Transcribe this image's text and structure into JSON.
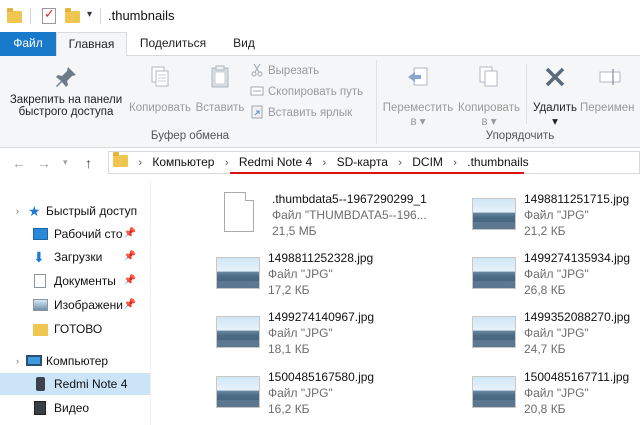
{
  "window": {
    "title": ".thumbnails"
  },
  "tabs": [
    {
      "label": "Файл"
    },
    {
      "label": "Главная"
    },
    {
      "label": "Поделиться"
    },
    {
      "label": "Вид"
    }
  ],
  "ribbon": {
    "clipboard": {
      "pin_label_1": "Закрепить на панели",
      "pin_label_2": "быстрого доступа",
      "copy_label": "Копировать",
      "paste_label": "Вставить",
      "cut_label": "Вырезать",
      "copy_path_label": "Скопировать путь",
      "paste_shortcut_label": "Вставить ярлык",
      "group_label": "Буфер обмена"
    },
    "organize": {
      "move_label": "Переместить",
      "move_sub": "в",
      "copyto_label": "Копировать",
      "copyto_sub": "в",
      "delete_label": "Удалить",
      "rename_label": "Переимен",
      "group_label": "Упорядочить"
    }
  },
  "address": {
    "crumbs": [
      "Компьютер",
      "Redmi Note 4",
      "SD-карта",
      "DCIM",
      ".thumbnails"
    ]
  },
  "nav": {
    "items": [
      {
        "label": "Быстрый доступ",
        "pinned": false
      },
      {
        "label": "Рабочий сто",
        "pinned": true
      },
      {
        "label": "Загрузки",
        "pinned": true
      },
      {
        "label": "Документы",
        "pinned": true
      },
      {
        "label": "Изображени",
        "pinned": true
      },
      {
        "label": "ГОТОВО",
        "pinned": false
      },
      {
        "label": "Компьютер",
        "pinned": false
      },
      {
        "label": "Redmi Note 4",
        "pinned": false
      },
      {
        "label": "Видео",
        "pinned": false
      }
    ]
  },
  "files": [
    {
      "name": ".thumbdata5--1967290299_1",
      "type": "Файл \"THUMBDATA5--196...",
      "size": "21,5 МБ",
      "icon": "document"
    },
    {
      "name": "1498811251715.jpg",
      "type": "Файл \"JPG\"",
      "size": "21,2 КБ",
      "icon": "image"
    },
    {
      "name": "1498811252328.jpg",
      "type": "Файл \"JPG\"",
      "size": "17,2 КБ",
      "icon": "image"
    },
    {
      "name": "1499274135934.jpg",
      "type": "Файл \"JPG\"",
      "size": "26,8 КБ",
      "icon": "image"
    },
    {
      "name": "1499274140967.jpg",
      "type": "Файл \"JPG\"",
      "size": "18,1 КБ",
      "icon": "image"
    },
    {
      "name": "1499352088270.jpg",
      "type": "Файл \"JPG\"",
      "size": "24,7 КБ",
      "icon": "image"
    },
    {
      "name": "1500485167580.jpg",
      "type": "Файл \"JPG\"",
      "size": "16,2 КБ",
      "icon": "image"
    },
    {
      "name": "1500485167711.jpg",
      "type": "Файл \"JPG\"",
      "size": "20,8 КБ",
      "icon": "image"
    }
  ],
  "colors": {
    "accent": "#1979ca",
    "selection": "#cce4f7",
    "underline": "#dd1111"
  }
}
